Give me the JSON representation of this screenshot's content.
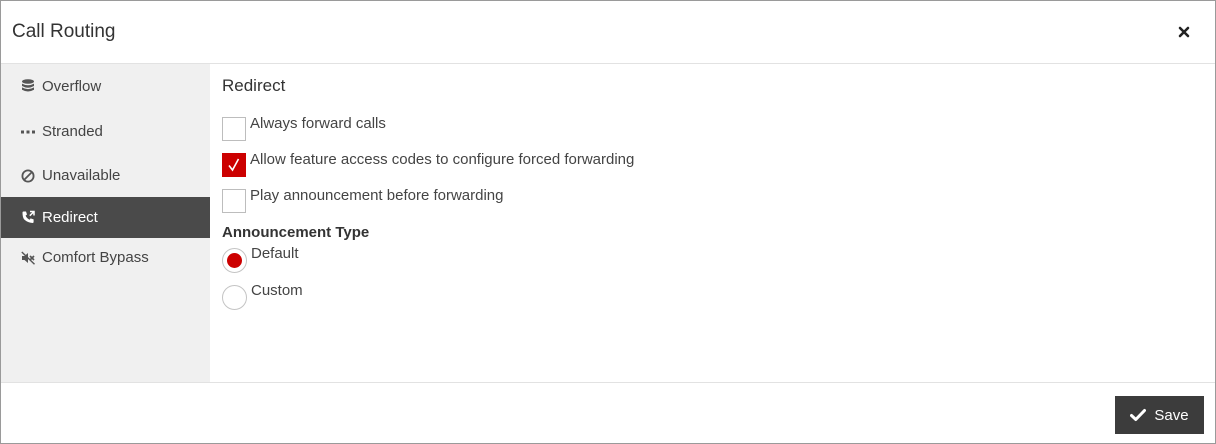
{
  "dialog": {
    "title": "Call Routing",
    "close_icon": "close-icon"
  },
  "sidebar": {
    "items": [
      {
        "label": "Overflow",
        "icon": "database-icon",
        "active": false
      },
      {
        "label": "Stranded",
        "icon": "ellipsis-icon",
        "active": false
      },
      {
        "label": "Unavailable",
        "icon": "ban-icon",
        "active": false
      },
      {
        "label": "Redirect",
        "icon": "phone-forward-icon",
        "active": true
      },
      {
        "label": "Comfort Bypass",
        "icon": "mute-icon",
        "active": false
      }
    ]
  },
  "main": {
    "section_title": "Redirect",
    "options": [
      {
        "label": "Always forward calls",
        "checked": false
      },
      {
        "label": "Allow feature access codes to configure forced forwarding",
        "checked": true
      },
      {
        "label": "Play announcement before forwarding",
        "checked": false
      }
    ],
    "announcement": {
      "label": "Announcement Type",
      "choices": [
        {
          "label": "Default",
          "selected": true
        },
        {
          "label": "Custom",
          "selected": false
        }
      ]
    }
  },
  "footer": {
    "save_label": "Save",
    "save_icon": "check-icon"
  },
  "colors": {
    "accent": "#cc0000",
    "active_nav": "#4a4a4a",
    "sidebar_bg": "#f0f0f0",
    "button_bg": "#3c3c3c"
  }
}
